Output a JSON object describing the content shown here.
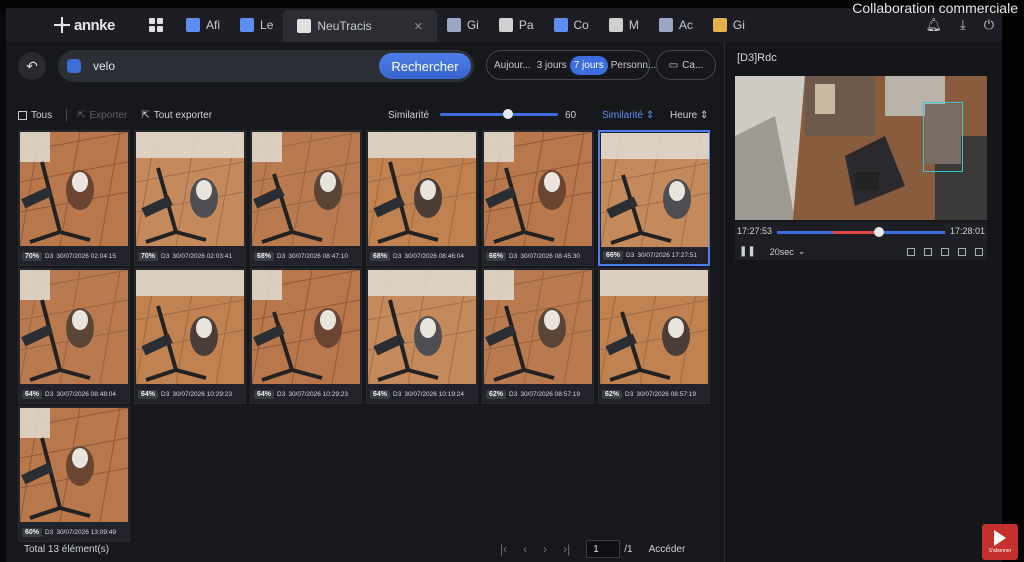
{
  "overlay": {
    "watermark": "Collaboration commerciale",
    "subscribe_label": "S'abonner"
  },
  "brand": {
    "logo_text": "annke"
  },
  "nav": {
    "tabs": [
      {
        "label": "Afi",
        "icon": "camera-icon",
        "color": "#5b8ef0"
      },
      {
        "label": "Le",
        "icon": "playback-icon",
        "color": "#5b8ef0"
      },
      {
        "label": "NeuTracis",
        "icon": "search-icon",
        "color": "#e0e0e0",
        "active": true
      },
      {
        "label": "Gi",
        "icon": "disk-icon",
        "color": "#9aa6c4"
      },
      {
        "label": "Pa",
        "icon": "gear-icon",
        "color": "#d0d0d0"
      },
      {
        "label": "Co",
        "icon": "user-icon",
        "color": "#5b8ef0"
      },
      {
        "label": "M",
        "icon": "tools-icon",
        "color": "#d0d0d0"
      },
      {
        "label": "Ac",
        "icon": "network-icon",
        "color": "#9aa6c4"
      },
      {
        "label": "Gi",
        "icon": "folder-icon",
        "color": "#e1b24a"
      }
    ],
    "tab_close": "✕"
  },
  "search": {
    "value": "velo",
    "button_label": "Rechercher",
    "ranges": [
      {
        "label": "Aujour...",
        "active": false
      },
      {
        "label": "3 jours",
        "active": false
      },
      {
        "label": "7 jours",
        "active": true
      },
      {
        "label": "Personn...",
        "active": false
      }
    ],
    "camera_label": "Ca..."
  },
  "toolbar": {
    "select_all": "Tous",
    "export": "Exporter",
    "export_all": "Tout exporter",
    "similarity_label": "Similarité",
    "similarity_value": "60",
    "similarity_fraction": 0.58,
    "sort_similarity": "Similarité",
    "sort_time": "Heure"
  },
  "results": [
    {
      "pct": "70%",
      "cam": "D3",
      "time": "30/07/2026 02:04:15"
    },
    {
      "pct": "70%",
      "cam": "D3",
      "time": "30/07/2026 02:03:41"
    },
    {
      "pct": "68%",
      "cam": "D3",
      "time": "30/07/2026 08:47:10"
    },
    {
      "pct": "68%",
      "cam": "D3",
      "time": "30/07/2026 08:46:04"
    },
    {
      "pct": "66%",
      "cam": "D3",
      "time": "30/07/2026 08:45:30"
    },
    {
      "pct": "66%",
      "cam": "D3",
      "time": "30/07/2026 17:27:51",
      "selected": true
    },
    {
      "pct": "64%",
      "cam": "D3",
      "time": "30/07/2026 08:48:04"
    },
    {
      "pct": "64%",
      "cam": "D3",
      "time": "30/07/2026 10:29:23"
    },
    {
      "pct": "64%",
      "cam": "D3",
      "time": "30/07/2026 10:29:23"
    },
    {
      "pct": "64%",
      "cam": "D3",
      "time": "30/07/2026 10:19:24"
    },
    {
      "pct": "62%",
      "cam": "D3",
      "time": "30/07/2026 08:57:19"
    },
    {
      "pct": "62%",
      "cam": "D3",
      "time": "30/07/2026 08:57:19"
    },
    {
      "pct": "60%",
      "cam": "D3",
      "time": "30/07/2026 13:09:49"
    }
  ],
  "footer": {
    "total": "Total 13 élément(s)",
    "page": "1",
    "page_total": "/1",
    "go": "Accéder"
  },
  "player": {
    "title": "[D3]Rdc",
    "start_time": "17:27:53",
    "end_time": "17:28:01",
    "progress": 0.34,
    "speed": "20sec"
  }
}
